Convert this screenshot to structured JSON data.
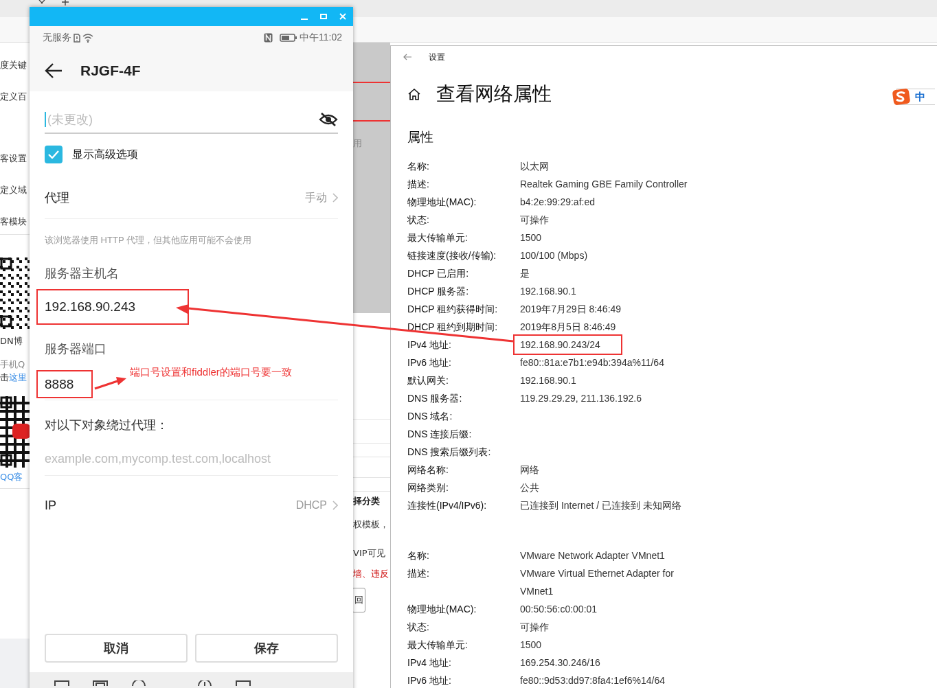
{
  "background_page": {
    "left_items": [
      {
        "kind": "text",
        "text": "度关键"
      },
      {
        "kind": "text",
        "text": "定义百"
      },
      {
        "kind": "text",
        "text": "客设置"
      },
      {
        "kind": "text",
        "text": "定义域"
      },
      {
        "kind": "text",
        "text": "客模块"
      },
      {
        "kind": "picture"
      },
      {
        "kind": "text",
        "text": "DN博"
      },
      {
        "kind": "muted",
        "text": "手机Q"
      },
      {
        "kind": "link",
        "text": "击",
        "link": "这里"
      },
      {
        "kind": "picture"
      },
      {
        "kind": "linktext",
        "text": "QQ客"
      }
    ],
    "middle_items": [
      {
        "kind": "muted",
        "text": "用"
      },
      {
        "kind": "bold",
        "text": "择分类"
      },
      {
        "kind": "text",
        "text": "权模板，"
      },
      {
        "kind": "text",
        "text": "VIP可见"
      },
      {
        "kind": "warning",
        "text": "墙、违反"
      },
      {
        "kind": "button",
        "text": "回"
      }
    ]
  },
  "phone": {
    "status_bar": {
      "carrier": "无服务",
      "time": "中午11:02"
    },
    "title": "RJGF-4F",
    "password": {
      "placeholder": "(未更改)"
    },
    "advanced": {
      "label": "显示高级选项",
      "checked": true
    },
    "proxy": {
      "label": "代理",
      "value": "手动"
    },
    "note": "该浏览器使用 HTTP 代理，但其他应用可能不会使用",
    "host": {
      "label": "服务器主机名",
      "value": "192.168.90.243",
      "highlighted": true
    },
    "port": {
      "label": "服务器端口",
      "value": "8888",
      "highlighted": true
    },
    "annotation": "端口号设置和fiddler的端口号要一致",
    "bypass": {
      "label": "对以下对象绕过代理：",
      "placeholder": "example.com,mycomp.test.com,localhost"
    },
    "ip": {
      "label": "IP",
      "value": "DHCP"
    },
    "buttons": [
      "取消",
      "保存"
    ]
  },
  "settings": {
    "title": "设置",
    "heading": "查看网络属性",
    "section": "属性",
    "ime": "中",
    "adapters": [
      {
        "rows": [
          {
            "label": "名称:",
            "value": "以太网",
            "highlighted": false
          },
          {
            "label": "描述:",
            "value": "Realtek Gaming GBE Family Controller",
            "highlighted": false
          },
          {
            "label": "物理地址(MAC):",
            "value": "b4:2e:99:29:af:ed",
            "highlighted": false
          },
          {
            "label": "状态:",
            "value": "可操作",
            "highlighted": false
          },
          {
            "label": "最大传输单元:",
            "value": "1500",
            "highlighted": false
          },
          {
            "label": "链接速度(接收/传输):",
            "value": "100/100 (Mbps)",
            "highlighted": false
          },
          {
            "label": "DHCP 已启用:",
            "value": "是",
            "highlighted": false
          },
          {
            "label": "DHCP 服务器:",
            "value": "192.168.90.1",
            "highlighted": false
          },
          {
            "label": "DHCP 租约获得时间:",
            "value": "2019年7月29日 8:46:49",
            "highlighted": false
          },
          {
            "label": "DHCP 租约到期时间:",
            "value": "2019年8月5日 8:46:49",
            "highlighted": false
          },
          {
            "label": "IPv4 地址:",
            "value": "192.168.90.243/24",
            "highlighted": true
          },
          {
            "label": "IPv6 地址:",
            "value": "fe80::81a:e7b1:e94b:394a%11/64",
            "highlighted": false
          },
          {
            "label": "默认网关:",
            "value": "192.168.90.1",
            "highlighted": false
          },
          {
            "label": "DNS 服务器:",
            "value": "119.29.29.29, 211.136.192.6",
            "highlighted": false
          },
          {
            "label": "DNS 域名:",
            "highlighted": false
          },
          {
            "label": "DNS 连接后缀:",
            "highlighted": false
          },
          {
            "label": "DNS 搜索后缀列表:",
            "highlighted": false
          },
          {
            "label": "网络名称:",
            "value": "网络",
            "highlighted": false
          },
          {
            "label": "网络类别:",
            "value": "公共",
            "highlighted": false
          },
          {
            "label": "连接性(IPv4/IPv6):",
            "value": "已连接到 Internet / 已连接到 未知网络",
            "highlighted": false
          }
        ]
      },
      {
        "rows": [
          {
            "label": "名称:",
            "value": "VMware Network Adapter VMnet1",
            "highlighted": false
          },
          {
            "label": "描述:",
            "value": "VMware Virtual Ethernet Adapter for VMnet1",
            "highlighted": false
          },
          {
            "label": "物理地址(MAC):",
            "value": "00:50:56:c0:00:01",
            "highlighted": false
          },
          {
            "label": "状态:",
            "value": "可操作",
            "highlighted": false
          },
          {
            "label": "最大传输单元:",
            "value": "1500",
            "highlighted": false
          },
          {
            "label": "IPv4 地址:",
            "value": "169.254.30.246/16",
            "highlighted": false
          },
          {
            "label": "IPv6 地址:",
            "value": "fe80::9d53:dd97:8fa4:1ef6%14/64",
            "highlighted": false
          }
        ]
      }
    ]
  }
}
